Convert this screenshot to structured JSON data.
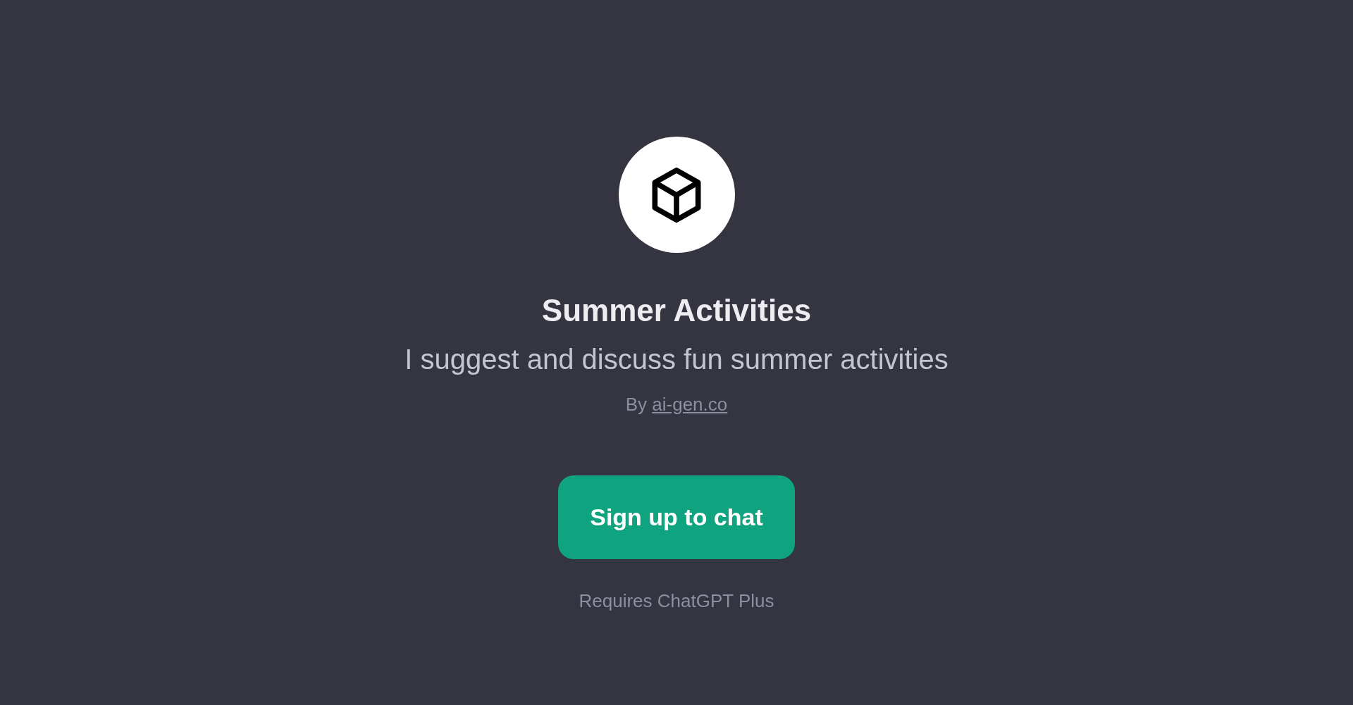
{
  "title": "Summer Activities",
  "description": "I suggest and discuss fun summer activities",
  "author": {
    "prefix": "By",
    "link": "ai-gen.co"
  },
  "button": {
    "label": "Sign up to chat"
  },
  "note": "Requires ChatGPT Plus"
}
